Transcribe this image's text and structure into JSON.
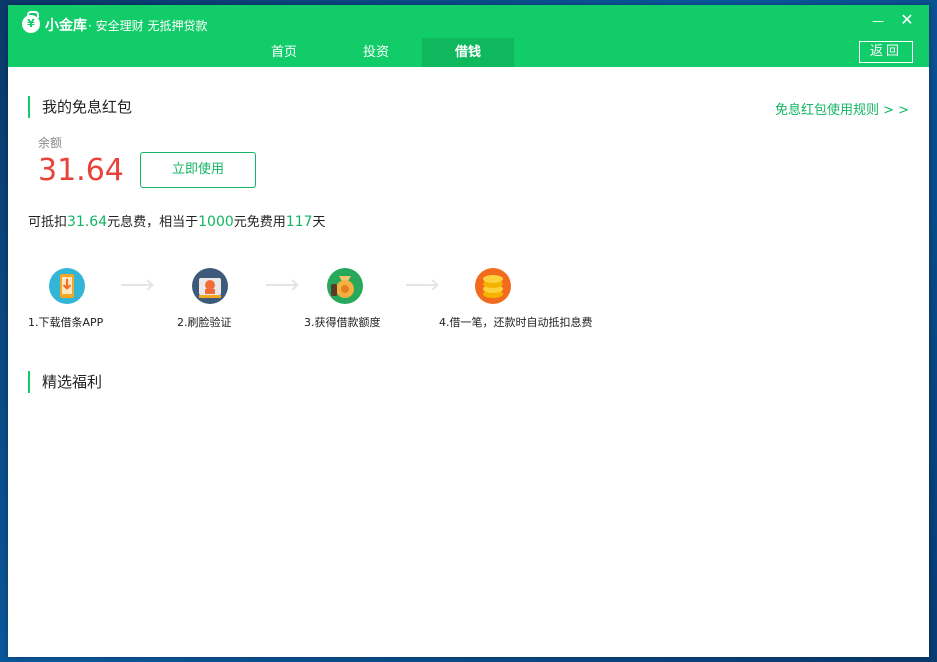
{
  "app": {
    "logo_char": "¥",
    "name": "小金库",
    "slogan": "· 安全理财 无抵押贷款",
    "minimize_glyph": "—",
    "close_glyph": "✕"
  },
  "nav": {
    "tabs": [
      {
        "label": "首页",
        "active": false
      },
      {
        "label": "投资",
        "active": false
      },
      {
        "label": "借钱",
        "active": true
      }
    ],
    "back_label": "返回"
  },
  "redpacket": {
    "title": "我的免息红包",
    "rules_link": "免息红包使用规则 > >",
    "balance_label": "余额",
    "balance_value": "31.64",
    "use_button": "立即使用"
  },
  "summary": {
    "t1": "可抵扣",
    "v1": "31.64",
    "t2": "元息费，相当于",
    "v2": "1000",
    "t3": "元免费用",
    "v3": "117",
    "t4": "天"
  },
  "steps": [
    {
      "label": "1.下载借条APP",
      "icon": "phone-download-icon"
    },
    {
      "label": "2.刷脸验证",
      "icon": "face-verify-icon"
    },
    {
      "label": "3.获得借款额度",
      "icon": "money-bag-icon"
    },
    {
      "label": "4.借一笔，还款时自动抵扣息费",
      "icon": "coin-stack-icon"
    }
  ],
  "welfare": {
    "title": "精选福利"
  },
  "colors": {
    "brand_green": "#12cc6a",
    "link_green": "#12b563",
    "amount_red": "#e8433a"
  }
}
